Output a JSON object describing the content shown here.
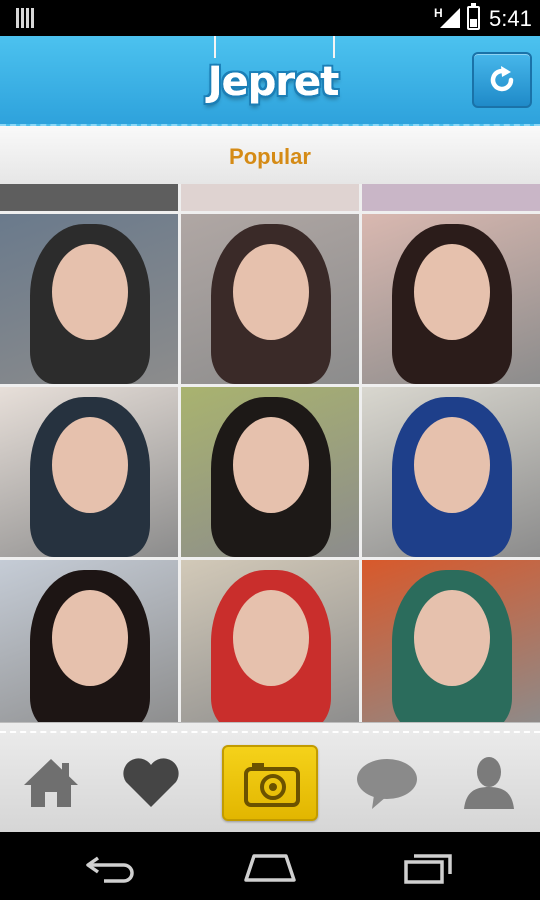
{
  "status_bar": {
    "time": "5:41",
    "network": "H"
  },
  "header": {
    "logo_text": "Jepret"
  },
  "section": {
    "title": "Popular"
  },
  "photos": [
    {
      "bg": "#6a7a8c",
      "accent": "#2c2c2c"
    },
    {
      "bg": "#b0a7a4",
      "accent": "#3a2a28"
    },
    {
      "bg": "#d9b8b0",
      "accent": "#2b1c1a"
    },
    {
      "bg": "#e7dfd9",
      "accent": "#26323f"
    },
    {
      "bg": "#a9b36f",
      "accent": "#1d1917"
    },
    {
      "bg": "#d9d7cf",
      "accent": "#1e3f8a"
    },
    {
      "bg": "#c5ccd6",
      "accent": "#1d1514"
    },
    {
      "bg": "#d2c9b8",
      "accent": "#c92e2c"
    },
    {
      "bg": "#d8592b",
      "accent": "#2b6c5c"
    },
    {
      "bg": "#d5b1b9",
      "accent": "#5c2f27"
    },
    {
      "bg": "#7fb7bf",
      "accent": "#3d271b"
    },
    {
      "bg": "#c7cad0",
      "accent": "#181818"
    }
  ],
  "tabs": [
    {
      "name": "home"
    },
    {
      "name": "favorites"
    },
    {
      "name": "camera",
      "active": true
    },
    {
      "name": "messages"
    },
    {
      "name": "profile"
    }
  ],
  "colors": {
    "header": "#34a9e0",
    "title": "#d58b16",
    "camera_button": "#eec40c"
  }
}
